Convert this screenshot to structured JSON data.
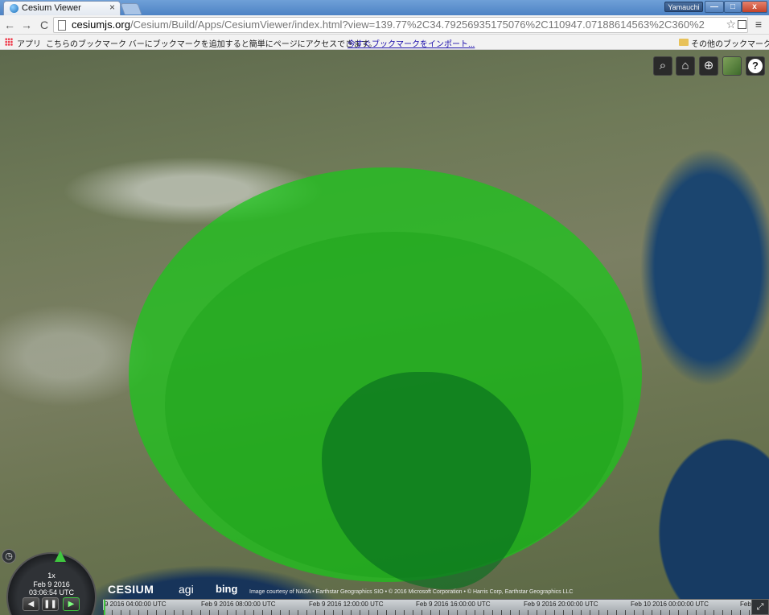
{
  "browser": {
    "tab_title": "Cesium Viewer",
    "tab_close": "×",
    "user": "Yamauchi",
    "win_min": "—",
    "win_max": "□",
    "win_close": "x",
    "back": "←",
    "forward": "→",
    "reload": "C",
    "url_host": "cesiumjs.org",
    "url_path": "/Cesium/Build/Apps/CesiumViewer/index.html?view=139.77%2C34.79256935175076%2C110947.07188614563%2C360%2",
    "star": "☆",
    "menu": "≡"
  },
  "bookmarks": {
    "apps": "アプリ",
    "message": "こちらのブックマーク バーにブックマークを追加すると簡単にページにアクセスできます。",
    "import_link": "今すぐブックマークをインポート...",
    "other": "その他のブックマーク"
  },
  "viewer": {
    "toolbar": {
      "search": "⌕",
      "home": "⌂",
      "scene": "⊕",
      "help": "?"
    },
    "animation": {
      "speed": "1x",
      "date": "Feb 9 2016",
      "time": "03:06:54 UTC",
      "reverse": "◀",
      "pause": "❚❚",
      "play": "▶",
      "clock": "◷"
    },
    "credits": {
      "cesium": "CESIUM",
      "agi": "agi",
      "bing": "bing",
      "text": "Image courtesy of NASA • Earthstar Geographics SIO • © 2016 Microsoft Corporation • © Harris Corp, Earthstar Geographics LLC"
    },
    "timeline": {
      "labels": [
        "9 2016 04:00:00 UTC",
        "Feb 9 2016 08:00:00 UTC",
        "Feb 9 2016 12:00:00 UTC",
        "Feb 9 2016 16:00:00 UTC",
        "Feb 9 2016 20:00:00 UTC",
        "Feb 10 2016 00:00:00 UTC",
        "Feb"
      ]
    },
    "fullscreen": "⤢"
  },
  "colors": {
    "ellipse_fill": "#19c819",
    "accent_green": "#3fc63f"
  }
}
